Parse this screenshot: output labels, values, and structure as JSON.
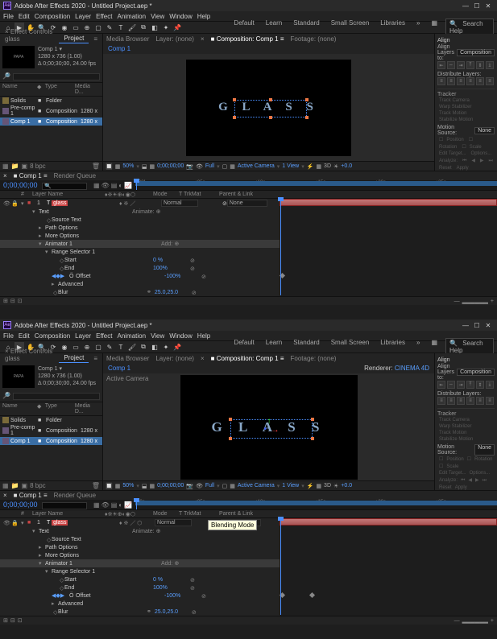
{
  "top": {
    "titlebar": "Adobe After Effects 2020 - Untitled Project.aep *",
    "menu": [
      "File",
      "Edit",
      "Composition",
      "Layer",
      "Effect",
      "Animation",
      "View",
      "Window",
      "Help"
    ],
    "workspaces": [
      "Default",
      "Learn",
      "Standard",
      "Small Screen",
      "Libraries"
    ],
    "search_help": "Search Help",
    "effect_controls_label": "Effect Controls glass",
    "panel_tabs": {
      "project": "Project",
      "media_browser": "Media Browser",
      "layer": "Layer: (none)",
      "composition": "Composition: Comp 1",
      "footage": "Footage: (none)"
    },
    "comp_crumb": "Comp 1",
    "proj_info_name": "Comp 1 ▾",
    "proj_info_dims": "1280 x 736 (1.00)",
    "proj_info_dur": "Δ 0;00;30;00, 24.00 fps",
    "proj_thumb_text": "PAPA",
    "proj_headers": {
      "name": "Name",
      "tag": "◆",
      "type": "Type",
      "size": "Media D..."
    },
    "proj_rows": [
      {
        "icon": "folder",
        "name": "Solids",
        "type": "Folder",
        "size": ""
      },
      {
        "icon": "comp",
        "name": "Pre-comp 1",
        "type": "Composition",
        "size": "1280 x"
      },
      {
        "icon": "comp",
        "name": "Comp 1",
        "type": "Composition",
        "size": "1280 x",
        "selected": true
      }
    ],
    "proj_footer_bpc": "8 bpc",
    "viewport_text": "G L A S S",
    "preview_footer": {
      "zoom": "50%",
      "timecode": "0;00;00;00",
      "res": "Full",
      "cam": "Active Camera",
      "views": "1 View",
      "px": "+0.0"
    },
    "align": {
      "title": "Align",
      "layers_to_label": "Align Layers to:",
      "layers_to_value": "Composition",
      "distribute": "Distribute Layers:"
    },
    "tracker": {
      "title": "Tracker",
      "motion_src_label": "Motion Source:",
      "motion_src_value": "None",
      "buttons": [
        "Track Camera",
        "Warp Stabilizer",
        "Track Motion",
        "Stabilize Motion"
      ],
      "opts": [
        "Position",
        "Rotation",
        "Scale"
      ],
      "edit": "Edit Target...",
      "options": "Options...",
      "analyze": "Analyze:",
      "reset": "Reset",
      "apply": "Apply"
    },
    "timeline": {
      "tabs": {
        "comp": "Comp 1",
        "rq": "Render Queue"
      },
      "timecode": "0;00;00;00",
      "col_headers": {
        "idx": "#",
        "name": "Layer Name",
        "mode": "Mode",
        "trk": "T TrkMat",
        "parent": "Parent & Link"
      },
      "layer": {
        "idx": "1",
        "name": "glass",
        "mode": "Normal",
        "parent": "None"
      },
      "props": {
        "text": "Text",
        "source_text": "Source Text",
        "path_options": "Path Options",
        "more_options": "More Options",
        "animator": "Animator 1",
        "range_sel": "Range Selector 1",
        "start": "Start",
        "start_val": "0 %",
        "end": "End",
        "end_val": "100%",
        "offset": "Offset",
        "offset_val": "-100%",
        "advanced": "Advanced",
        "blur": "Blur",
        "blur_val": "25.0,25.0",
        "animate_btn": "Animate: ⊕",
        "add_btn": "Add: ⊕"
      },
      "ruler_marks": [
        ":00f",
        "05s",
        "10s",
        "15s",
        "20s",
        "25s"
      ]
    }
  },
  "bottom": {
    "titlebar": "Adobe After Effects 2020 - Untitled Project.aep *",
    "renderer_label": "Renderer:",
    "renderer_value": "CINEMA 4D",
    "active_camera_label": "Active Camera",
    "timeline": {
      "timecode": "0;00;00;00",
      "ruler_marks": [
        "00s",
        "05s",
        "10s",
        "15s",
        "20s",
        "25s"
      ],
      "tooltip": "Blending Mode"
    }
  }
}
